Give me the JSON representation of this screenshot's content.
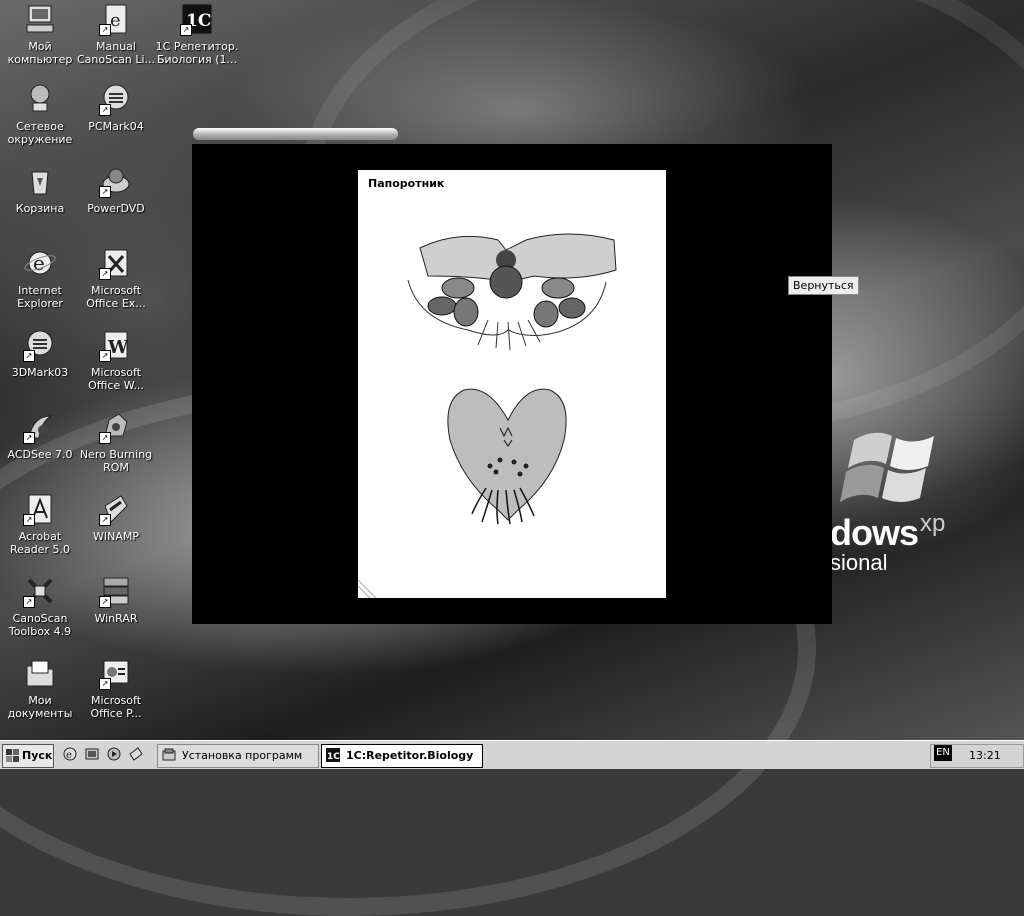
{
  "desktop": {
    "icons": [
      {
        "label": "Мой\nкомпьютер",
        "icon": "my-computer-icon",
        "shortcut": false
      },
      {
        "label": "Manual\nCanoScan Li...",
        "icon": "ie-document-icon",
        "shortcut": true
      },
      {
        "label": "1С Репетитор.\nБиология (1...",
        "icon": "1c-app-icon",
        "shortcut": true
      },
      {
        "label": "Сетевое\nокружение",
        "icon": "network-icon",
        "shortcut": false
      },
      {
        "label": "PCMark04",
        "icon": "pcmark-icon",
        "shortcut": true
      },
      {
        "label": "Корзина",
        "icon": "recycle-bin-icon",
        "shortcut": false
      },
      {
        "label": "PowerDVD",
        "icon": "powerdvd-icon",
        "shortcut": true
      },
      {
        "label": "Internet\nExplorer",
        "icon": "internet-explorer-icon",
        "shortcut": false
      },
      {
        "label": "Microsoft\nOffice Ex...",
        "icon": "excel-icon",
        "shortcut": true
      },
      {
        "label": "3DMark03",
        "icon": "3dmark-icon",
        "shortcut": true
      },
      {
        "label": "Microsoft\nOffice W...",
        "icon": "word-icon",
        "shortcut": true
      },
      {
        "label": "ACDSee 7.0",
        "icon": "acdsee-icon",
        "shortcut": true
      },
      {
        "label": "Nero Burning\nROM",
        "icon": "nero-icon",
        "shortcut": true
      },
      {
        "label": "Acrobat\nReader 5.0",
        "icon": "acrobat-icon",
        "shortcut": true
      },
      {
        "label": "WINAMP",
        "icon": "winamp-icon",
        "shortcut": true
      },
      {
        "label": "CanoScan\nToolbox 4.9",
        "icon": "canoscan-icon",
        "shortcut": true
      },
      {
        "label": "WinRAR",
        "icon": "winrar-icon",
        "shortcut": true
      },
      {
        "label": "Мои\nдокументы",
        "icon": "my-documents-icon",
        "shortcut": false
      },
      {
        "label": "Microsoft\nOffice P...",
        "icon": "powerpoint-icon",
        "shortcut": true
      }
    ],
    "wallpaper_brand": {
      "part1": "dows",
      "part2": "xp",
      "part3": "sional"
    }
  },
  "app": {
    "card_title": "Папоротник",
    "back_button": "Вернуться"
  },
  "taskbar": {
    "start_label": "Пуск",
    "tasks": [
      {
        "label": "Установка программ",
        "active": false
      },
      {
        "label": "1C:Repetitor.Biology",
        "active": true
      }
    ],
    "language": "EN",
    "tray_toggle": "«",
    "clock": "13:21"
  }
}
